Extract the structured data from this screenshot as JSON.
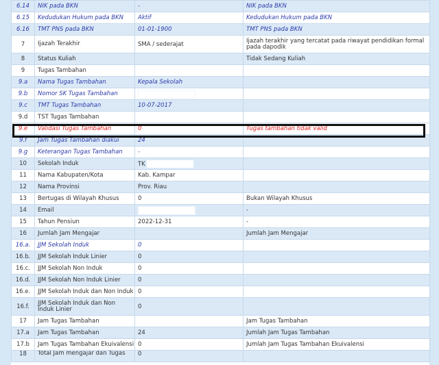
{
  "rows": [
    {
      "no": "6.14",
      "label": "NIK pada BKN",
      "value": "-",
      "info": "NIK pada BKN",
      "style": "sub",
      "zebra": "odd"
    },
    {
      "no": "6.15",
      "label": "Kedudukan Hukum pada BKN",
      "value": "Aktif",
      "info": "Kedudukan Hukum pada BKN",
      "style": "sub",
      "zebra": "even"
    },
    {
      "no": "6.16",
      "label": "TMT PNS pada BKN",
      "value": "01-01-1900",
      "info": "TMT PNS pada BKN",
      "style": "sub",
      "zebra": "odd"
    },
    {
      "no": "7",
      "label": "Ijazah Terakhir",
      "value": "SMA / sederajat",
      "info": "Ijazah terakhir yang tercatat pada riwayat pendidikan formal pada dapodik",
      "style": "",
      "zebra": "even",
      "tall": true
    },
    {
      "no": "8",
      "label": "Status Kuliah",
      "value": "",
      "info": "Tidak Sedang Kuliah",
      "style": "",
      "zebra": "odd"
    },
    {
      "no": "9",
      "label": "Tugas Tambahan",
      "value": "",
      "info": "",
      "style": "",
      "zebra": "even"
    },
    {
      "no": "9.a",
      "label": "Nama Tugas Tambahan",
      "value": "Kepala Sekolah",
      "info": "",
      "style": "sub",
      "zebra": "odd"
    },
    {
      "no": "9.b",
      "label": "Nomor SK Tugas Tambahan",
      "value": "",
      "info": "",
      "style": "sub",
      "zebra": "even",
      "mask": true
    },
    {
      "no": "9.c",
      "label": "TMT Tugas Tambahan",
      "value": "10-07-2017",
      "info": "",
      "style": "sub",
      "zebra": "odd"
    },
    {
      "no": "9.d",
      "label": "TST Tugas Tambahan",
      "value": "",
      "info": "",
      "style": "",
      "zebra": "even"
    },
    {
      "no": "9.e",
      "label": "Validasi Tugas Tambahan",
      "value": "0",
      "info": "Tugas tambahan tidak valid",
      "style": "danger",
      "zebra": "even"
    },
    {
      "no": "9.f",
      "label": "Jam Tugas Tambahan diakui",
      "value": "24",
      "info": "",
      "style": "sub",
      "zebra": "odd"
    },
    {
      "no": "9.g",
      "label": "Keterangan Tugas Tambahan",
      "value": "-",
      "info": "",
      "style": "sub",
      "zebra": "even"
    },
    {
      "no": "10",
      "label": "Sekolah Induk",
      "value": "TK",
      "info": "",
      "style": "",
      "zebra": "odd",
      "maskShort": true
    },
    {
      "no": "11",
      "label": "Nama Kabupaten/Kota",
      "value": "Kab. Kampar",
      "info": "",
      "style": "",
      "zebra": "even"
    },
    {
      "no": "12",
      "label": "Nama Provinsi",
      "value": "Prov. Riau",
      "info": "",
      "style": "",
      "zebra": "odd"
    },
    {
      "no": "13",
      "label": "Bertugas di Wilayah Khusus",
      "value": "0",
      "info": "Bukan Wilayah Khusus",
      "style": "",
      "zebra": "even"
    },
    {
      "no": "14",
      "label": "Email",
      "value": "",
      "info": "-",
      "style": "",
      "zebra": "odd",
      "mask": true
    },
    {
      "no": "15",
      "label": "Tahun Pensiun",
      "value": "2022-12-31",
      "info": "-",
      "style": "",
      "zebra": "even"
    },
    {
      "no": "16",
      "label": "Jumlah Jam Mengajar",
      "value": "",
      "info": "Jumlah Jam Mengajar",
      "style": "",
      "zebra": "odd"
    },
    {
      "no": "16.a.",
      "label": "JJM Sekolah Induk",
      "value": "0",
      "info": "",
      "style": "sub",
      "zebra": "even"
    },
    {
      "no": "16.b.",
      "label": "JJM Sekolah Induk Linier",
      "value": "0",
      "info": "",
      "style": "",
      "zebra": "odd"
    },
    {
      "no": "16.c.",
      "label": "JJM Sekolah Non Induk",
      "value": "0",
      "info": "",
      "style": "",
      "zebra": "even"
    },
    {
      "no": "16.d.",
      "label": "JJM Sekolah Non Induk Linier",
      "value": "0",
      "info": "",
      "style": "",
      "zebra": "odd"
    },
    {
      "no": "16.e.",
      "label": "JJM Sekolah Induk dan Non Induk",
      "value": "0",
      "info": "",
      "style": "",
      "zebra": "even"
    },
    {
      "no": "16.f.",
      "label": "JJM Sekolah Induk dan Non Induk Linier",
      "value": "0",
      "info": "",
      "style": "",
      "zebra": "odd",
      "tall": true
    },
    {
      "no": "17",
      "label": "Jam Tugas Tambahan",
      "value": "",
      "info": "Jam Tugas Tambahan",
      "style": "",
      "zebra": "even"
    },
    {
      "no": "17.a",
      "label": "Jam Tugas Tambahan",
      "value": "24",
      "info": "Jumlah Jam Tugas Tambahan",
      "style": "",
      "zebra": "odd"
    },
    {
      "no": "17.b",
      "label": "Jam Tugas Tambahan Ekuivalensi",
      "value": "0",
      "info": "Jumlah Jam Tugas Tambahan Ekuivalensi",
      "style": "",
      "zebra": "even"
    },
    {
      "no": "18",
      "label": "Total Jam mengajar dan Tugas",
      "value": "0",
      "info": "",
      "style": "",
      "zebra": "odd",
      "cut": true
    }
  ]
}
